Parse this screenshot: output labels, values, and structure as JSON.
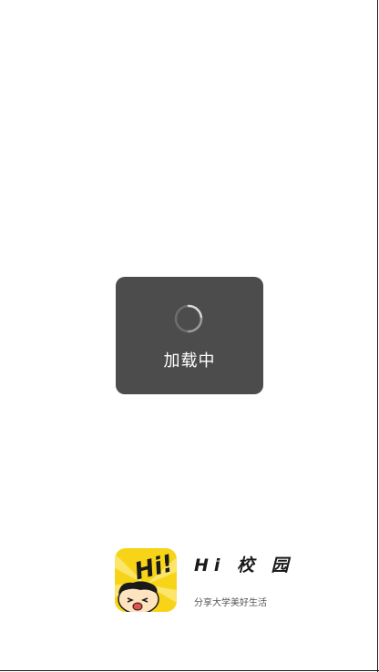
{
  "loading": {
    "label": "加载中"
  },
  "brand": {
    "icon": "hi-campus-app-icon",
    "icon_text": "Hi!",
    "name": "Hi 校 园",
    "slogan": "分享大学美好生活"
  },
  "colors": {
    "toast_bg": "#4c4c4c",
    "brand_yellow": "#f7d417",
    "background": "#ffffff"
  }
}
